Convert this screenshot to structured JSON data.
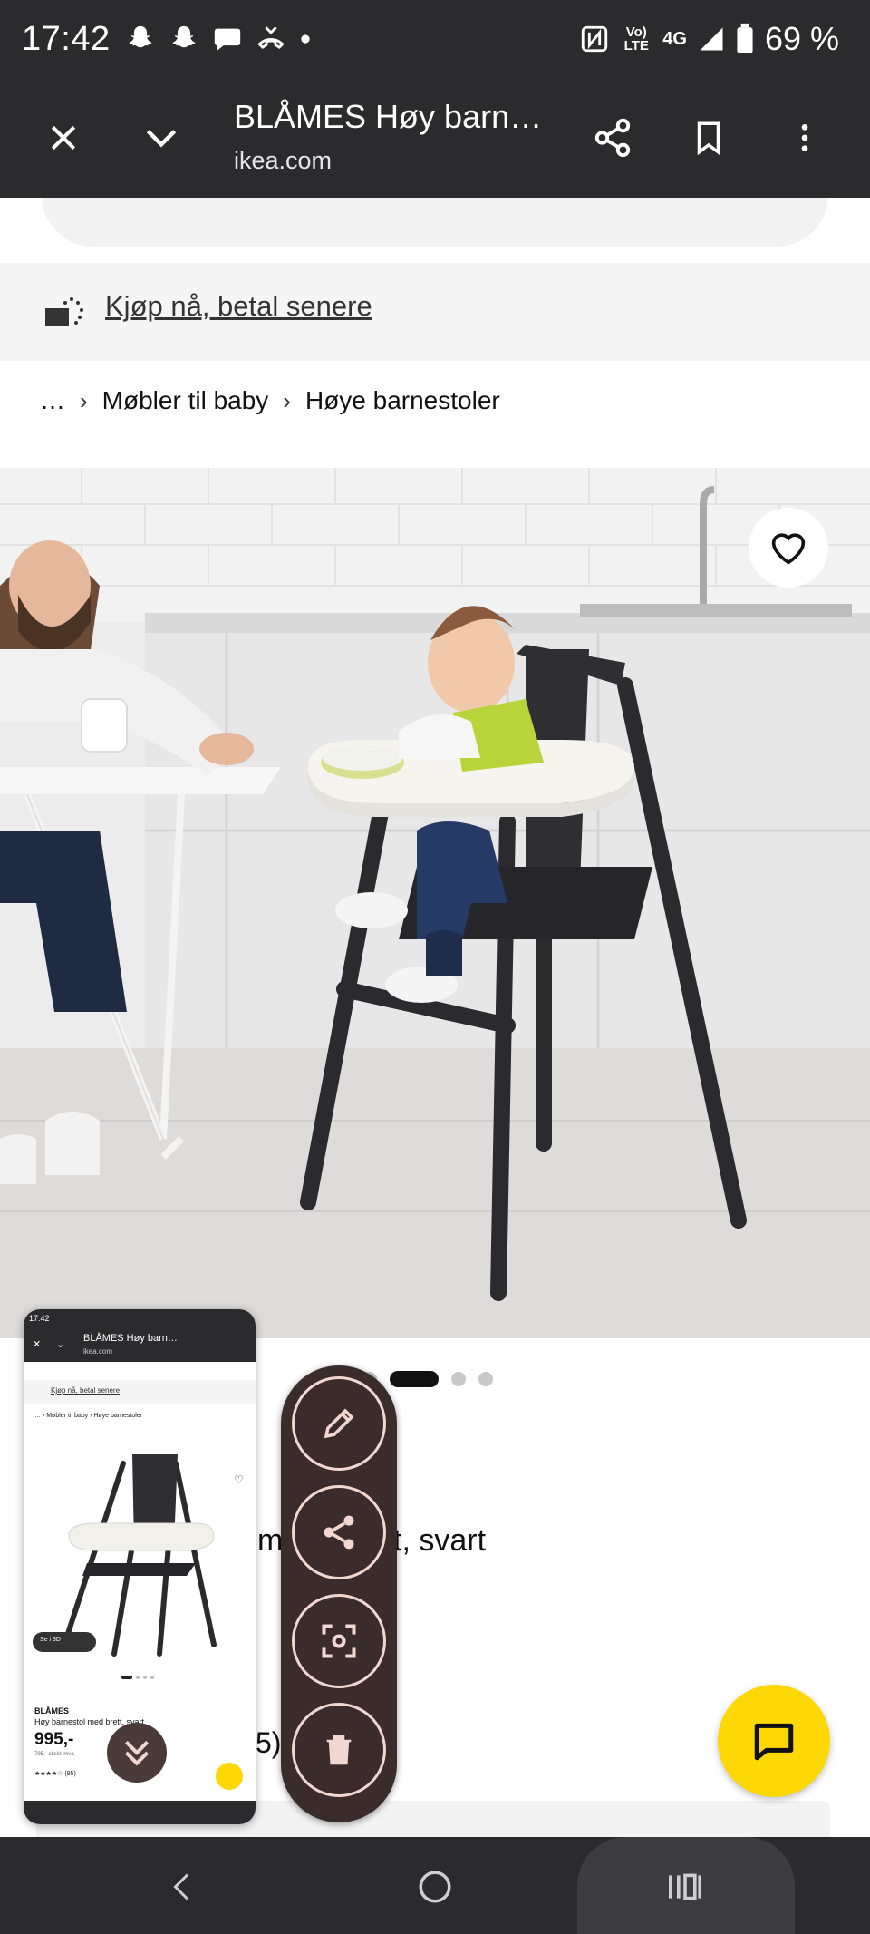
{
  "status_bar": {
    "time": "17:42",
    "battery": "69 %",
    "network": "4G",
    "volte": "Vo) LTE"
  },
  "browser": {
    "title": "BLÅMES Høy barn…",
    "url": "ikea.com"
  },
  "page": {
    "bnpl_link": "Kjøp nå, betal senere",
    "breadcrumb": [
      "…",
      "Møbler til baby",
      "Høye barnestoler"
    ],
    "product_name_fragment_left": "m",
    "product_name_fragment_right": "t, svart",
    "rating_fragment": "5)",
    "carousel": {
      "count": 4,
      "active": 1
    }
  },
  "thumbnail": {
    "status_time": "17:42",
    "title": "BLÅMES Høy barn…",
    "url": "ikea.com",
    "bnpl_link": "Kjøp nå, betal senere",
    "breadcrumb": "… › Møbler til baby › Høye barnestoler",
    "badge": "Se i 3D",
    "brand": "BLÅMES",
    "description": "Høy barnestol med brett, svart",
    "price": "995,-",
    "price_sub": "795,- ekskl. mva",
    "rating": "★★★★☆ (95)"
  },
  "colors": {
    "system_bar": "#2b2b2d",
    "toolbar": "#3a2c2a",
    "toolbar_ring": "#f0d7cf",
    "chat_fab": "#fdd805"
  },
  "icons": {
    "close": "close-icon",
    "collapse": "chevron-down-icon",
    "share": "share-icon",
    "bookmark": "bookmark-icon",
    "menu": "more-vert-icon",
    "favorite": "heart-icon",
    "edit": "pencil-icon",
    "scan": "scan-icon",
    "delete": "trash-icon",
    "chat": "chat-icon"
  }
}
